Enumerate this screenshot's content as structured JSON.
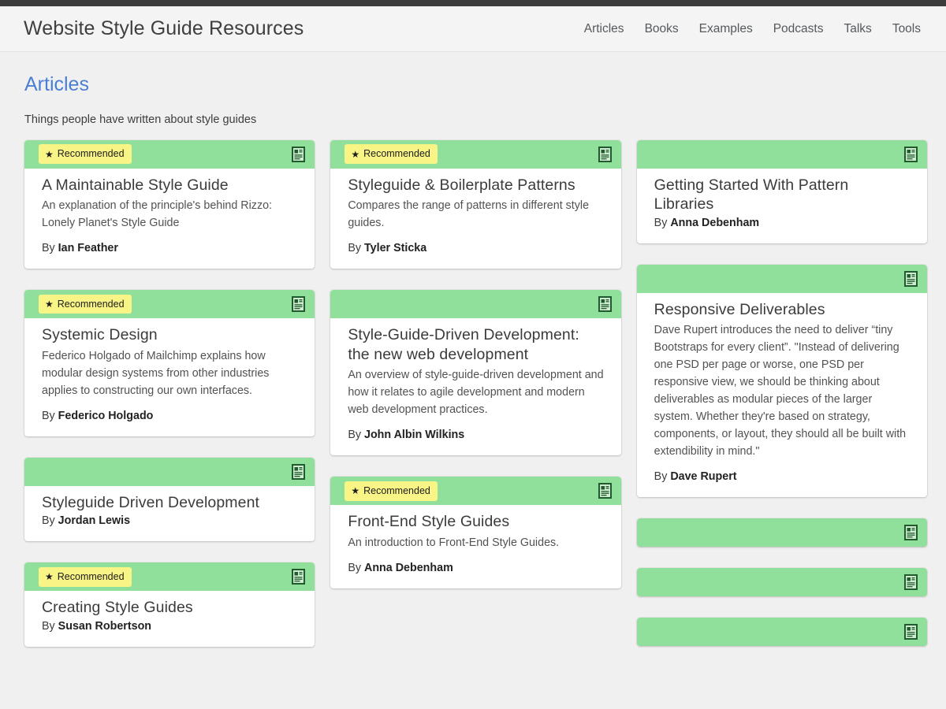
{
  "topbar": {
    "name": "window-chrome-bar"
  },
  "header": {
    "title": "Website Style Guide Resources",
    "nav": [
      {
        "label": "Articles"
      },
      {
        "label": "Books"
      },
      {
        "label": "Examples"
      },
      {
        "label": "Podcasts"
      },
      {
        "label": "Talks"
      },
      {
        "label": "Tools"
      }
    ]
  },
  "page": {
    "title": "Articles",
    "subtitle": "Things people have written about style guides"
  },
  "colors": {
    "accent": "#4a7fd4",
    "card_header": "#90e09b",
    "badge": "#f8f486",
    "icon": "#1f5b2e",
    "topbar": "#3c3c3c",
    "page_bg": "#f0f0f0"
  },
  "icons": {
    "article": "article-document-icon",
    "star": "★"
  },
  "badge_label": "Recommended",
  "by_prefix": "By ",
  "cards": [
    {
      "recommended": true,
      "title": "A Maintainable Style Guide",
      "desc": "An explanation of the principle's behind Rizzo: Lonely Planet's Style Guide",
      "author": "Ian Feather"
    },
    {
      "recommended": true,
      "title": "Systemic Design",
      "desc": "Federico Holgado of Mailchimp explains how modular design systems from other industries applies to constructing our own interfaces.",
      "author": "Federico Holgado"
    },
    {
      "recommended": false,
      "title": "Styleguide Driven Development",
      "desc": "",
      "author": "Jordan Lewis"
    },
    {
      "recommended": true,
      "title": "Creating Style Guides",
      "desc": "",
      "author": "Susan Robertson"
    },
    {
      "recommended": true,
      "title": "Styleguide & Boilerplate Patterns",
      "desc": "Compares the range of patterns in different style guides.",
      "author": "Tyler Sticka"
    },
    {
      "recommended": false,
      "title": "Style-Guide-Driven Development: the new web development",
      "desc": "An overview of style-guide-driven development and how it relates to agile development and modern web development practices.",
      "author": "John Albin Wilkins"
    },
    {
      "recommended": true,
      "title": "Front-End Style Guides",
      "desc": "An introduction to Front-End Style Guides.",
      "author": "Anna Debenham"
    },
    {
      "recommended": false,
      "title": "Getting Started With Pattern Libraries",
      "desc": "",
      "author": "Anna Debenham"
    },
    {
      "recommended": false,
      "title": "Responsive Deliverables",
      "desc": "Dave Rupert introduces the need to deliver “tiny Bootstraps for every client”. \"Instead of delivering one PSD per page or worse, one PSD per responsive view, we should be thinking about deliverables as modular pieces of the larger system. Whether they're based on strategy, components, or layout, they should all be built with extendibility in mind.\"",
      "author": "Dave Rupert"
    },
    {
      "recommended": false,
      "title": "",
      "desc": "",
      "author": ""
    },
    {
      "recommended": false,
      "title": "",
      "desc": "",
      "author": ""
    },
    {
      "recommended": false,
      "title": "",
      "desc": "",
      "author": ""
    }
  ]
}
